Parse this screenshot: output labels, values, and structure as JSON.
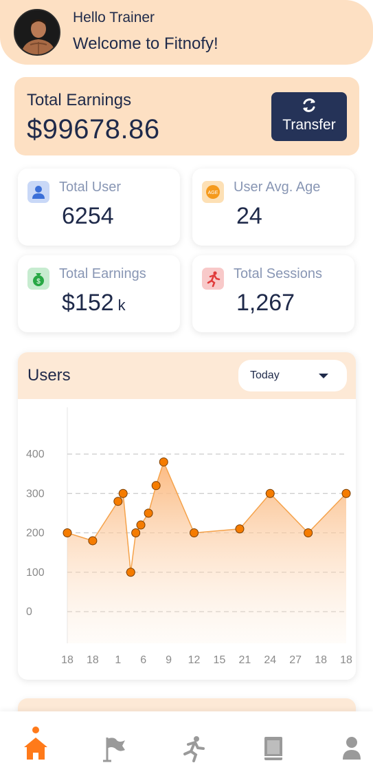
{
  "header": {
    "greeting": "Hello Trainer",
    "welcome": "Welcome to Fitnofy!"
  },
  "earnings_card": {
    "label": "Total Earnings",
    "value": "$99678.86",
    "transfer_label": "Transfer"
  },
  "stats": [
    {
      "title": "Total User",
      "value": "6254",
      "unit": "",
      "icon": "user-icon",
      "color": "#3b6fd8"
    },
    {
      "title": "User Avg. Age",
      "value": "24",
      "unit": "",
      "icon": "age-badge-icon",
      "color": "#f59a1c"
    },
    {
      "title": "Total Earnings",
      "value": "$152",
      "unit": "k",
      "icon": "money-bag-icon",
      "color": "#27a844"
    },
    {
      "title": "Total Sessions",
      "value": "1,267",
      "unit": "",
      "icon": "running-icon",
      "color": "#e03a3a"
    }
  ],
  "users_chart": {
    "title": "Users",
    "filter_selected": "Today"
  },
  "chart_data": {
    "type": "area",
    "title": "Users",
    "xlabel": "",
    "ylabel": "",
    "ylim": [
      0,
      400
    ],
    "yticks": [
      0,
      100,
      200,
      300,
      400
    ],
    "x_labels": [
      "18",
      "18",
      "1",
      "6",
      "9",
      "12",
      "15",
      "21",
      "24",
      "27",
      "18",
      "18"
    ],
    "points": [
      {
        "x": 0,
        "y": 200
      },
      {
        "x": 1,
        "y": 180
      },
      {
        "x": 2,
        "y": 280
      },
      {
        "x": 2.2,
        "y": 300
      },
      {
        "x": 2.5,
        "y": 100
      },
      {
        "x": 2.7,
        "y": 200
      },
      {
        "x": 2.9,
        "y": 220
      },
      {
        "x": 3.2,
        "y": 250
      },
      {
        "x": 3.5,
        "y": 320
      },
      {
        "x": 3.8,
        "y": 380
      },
      {
        "x": 5,
        "y": 200
      },
      {
        "x": 6.8,
        "y": 210
      },
      {
        "x": 8,
        "y": 300
      },
      {
        "x": 9.5,
        "y": 200
      },
      {
        "x": 11,
        "y": 300
      }
    ],
    "grid": "dashed horizontal",
    "colors": {
      "line": "#f5a24a",
      "point": "#f57c00",
      "fill": "#fbb67a"
    }
  },
  "nav": {
    "items": [
      {
        "name": "home",
        "active": true
      },
      {
        "name": "flag"
      },
      {
        "name": "workout"
      },
      {
        "name": "book"
      },
      {
        "name": "profile"
      }
    ],
    "colors": {
      "active": "#ff7a1a",
      "inactive": "#9a9a9a"
    }
  }
}
